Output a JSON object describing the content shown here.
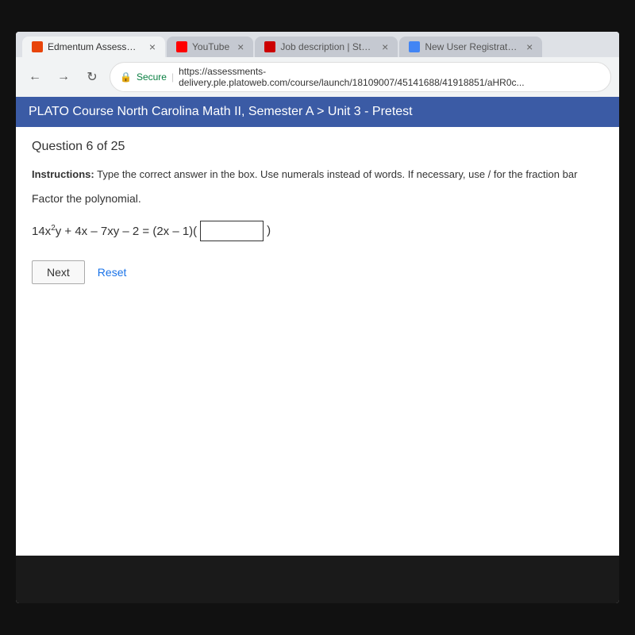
{
  "browser": {
    "tabs": [
      {
        "id": "edmentum",
        "label": "Edmentum Assessments",
        "favicon": "edmentum",
        "active": true
      },
      {
        "id": "youtube",
        "label": "YouTube",
        "favicon": "youtube",
        "active": false
      },
      {
        "id": "staples",
        "label": "Job description | Staples",
        "favicon": "staples",
        "active": false
      },
      {
        "id": "new-user",
        "label": "New User Registration",
        "favicon": "new-user",
        "active": false
      }
    ],
    "secure_label": "Secure",
    "url": "https://assessments-delivery.ple.platoweb.com/course/launch/18109007/45141688/41918851/aHR0c..."
  },
  "course": {
    "title": "PLATO Course North Carolina Math II, Semester A > Unit 3 - Pretest"
  },
  "question": {
    "counter": "Question 6 of 25",
    "instructions": "Type the correct answer in the box. Use numerals instead of words. If necessary, use / for the fraction bar",
    "problem_text": "Factor the polynomial.",
    "equation_prefix": "14x²y + 4x – 7xy – 2 = (2x – 1)(",
    "equation_suffix": ")",
    "input_placeholder": ""
  },
  "buttons": {
    "next_label": "Next",
    "reset_label": "Reset"
  }
}
